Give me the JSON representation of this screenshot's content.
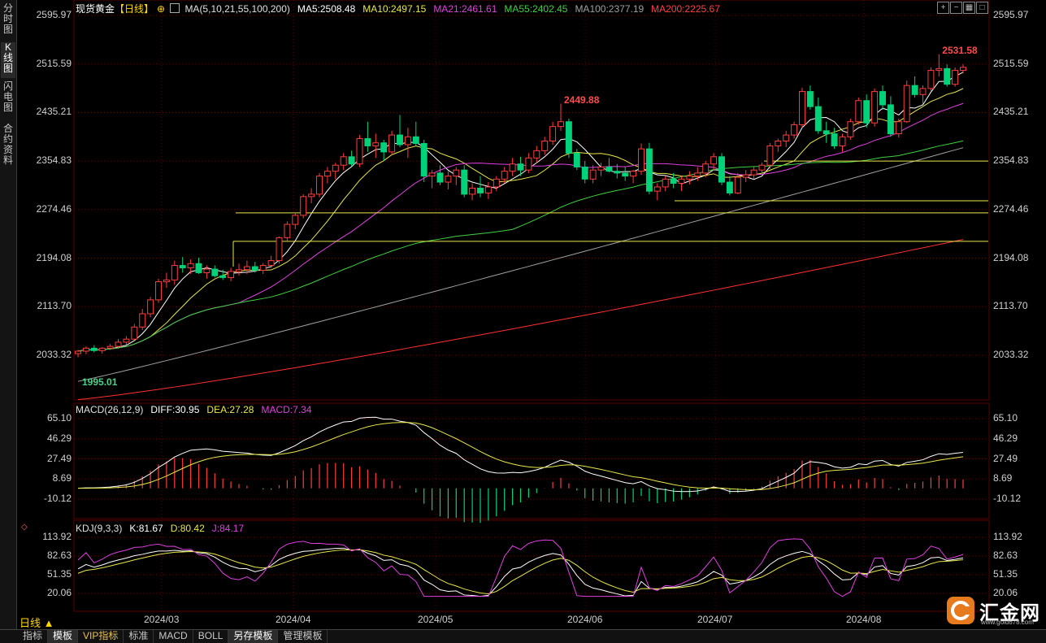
{
  "sidebar": {
    "tabs": [
      "分时图",
      "K线图",
      "闪电图",
      "合约资料"
    ],
    "active": 1
  },
  "header": {
    "symbol": "现货黄金",
    "period_tag": "【日线】",
    "ma": [
      {
        "text": "MA(5,10,21,55,100,200)",
        "color": "#e0e0e0"
      },
      {
        "text": "MA5:2508.48",
        "color": "#ffffff"
      },
      {
        "text": "MA10:2497.15",
        "color": "#e8e84a"
      },
      {
        "text": "MA21:2461.61",
        "color": "#e040e0"
      },
      {
        "text": "MA55:2402.45",
        "color": "#40d040"
      },
      {
        "text": "MA100:2377.19",
        "color": "#a0a0a0"
      },
      {
        "text": "MA200:2225.67",
        "color": "#ff4040"
      }
    ]
  },
  "macd_legend": [
    {
      "text": "MACD(26,12,9)",
      "color": "#e0e0e0"
    },
    {
      "text": "DIFF:30.95",
      "color": "#ffffff"
    },
    {
      "text": "DEA:27.28",
      "color": "#e8e84a"
    },
    {
      "text": "MACD:7.34",
      "color": "#e040e0"
    }
  ],
  "kdj_legend": [
    {
      "text": "KDJ(9,3,3)",
      "color": "#e0e0e0"
    },
    {
      "text": "K:81.67",
      "color": "#ffffff"
    },
    {
      "text": "D:80.42",
      "color": "#e8e84a"
    },
    {
      "text": "J:84.17",
      "color": "#e040e0"
    }
  ],
  "price_axis": [
    "2595.97",
    "2515.59",
    "2435.21",
    "2354.83",
    "2274.46",
    "2194.08",
    "2113.70",
    "2033.32"
  ],
  "macd_axis": [
    "65.10",
    "46.29",
    "27.49",
    "8.69",
    "-10.12"
  ],
  "kdj_axis": [
    "113.92",
    "82.63",
    "51.35",
    "20.06"
  ],
  "time_axis": [
    "2024/03",
    "2024/04",
    "2024/05",
    "2024/06",
    "2024/07",
    "2024/08"
  ],
  "annotations": {
    "high": "2531.58",
    "mid_high": "2449.88",
    "low": "1995.01"
  },
  "colors": {
    "up": "#ff3c3c",
    "down": "#00d27a",
    "grid": "#5a0000",
    "bg": "#000000"
  },
  "period_button": "日线 ▲",
  "bottom_tabs": [
    {
      "label": "指标",
      "active": false,
      "vip": false
    },
    {
      "label": "模板",
      "active": true,
      "vip": false
    },
    {
      "label": "VIP指标",
      "active": false,
      "vip": true
    },
    {
      "label": "标准",
      "active": false,
      "vip": false
    },
    {
      "label": "MACD",
      "active": false,
      "vip": false
    },
    {
      "label": "BOLL",
      "active": false,
      "vip": false
    },
    {
      "label": "另存模板",
      "active": true,
      "vip": false
    },
    {
      "label": "管理模板",
      "active": false,
      "vip": false
    }
  ],
  "logo": {
    "name": "汇金网",
    "url": "www.gold678.com"
  },
  "chart_data": {
    "type": "candlestick",
    "ohlc": [
      [
        2036,
        2042,
        2030,
        2040
      ],
      [
        2040,
        2048,
        2035,
        2045
      ],
      [
        2045,
        2050,
        2038,
        2041
      ],
      [
        2041,
        2047,
        2036,
        2045
      ],
      [
        2045,
        2052,
        2042,
        2048
      ],
      [
        2048,
        2060,
        2044,
        2055
      ],
      [
        2055,
        2065,
        2050,
        2060
      ],
      [
        2060,
        2085,
        2058,
        2080
      ],
      [
        2080,
        2110,
        2075,
        2102
      ],
      [
        2102,
        2130,
        2096,
        2125
      ],
      [
        2125,
        2160,
        2120,
        2155
      ],
      [
        2155,
        2170,
        2145,
        2158
      ],
      [
        2158,
        2190,
        2150,
        2182
      ],
      [
        2182,
        2196,
        2170,
        2178
      ],
      [
        2178,
        2192,
        2168,
        2185
      ],
      [
        2185,
        2195,
        2168,
        2170
      ],
      [
        2170,
        2182,
        2160,
        2176
      ],
      [
        2176,
        2182,
        2162,
        2165
      ],
      [
        2165,
        2175,
        2158,
        2162
      ],
      [
        2162,
        2178,
        2156,
        2172
      ],
      [
        2172,
        2185,
        2165,
        2175
      ],
      [
        2175,
        2190,
        2168,
        2180
      ],
      [
        2180,
        2188,
        2170,
        2174
      ],
      [
        2174,
        2186,
        2168,
        2182
      ],
      [
        2182,
        2198,
        2178,
        2190
      ],
      [
        2190,
        2230,
        2185,
        2228
      ],
      [
        2228,
        2255,
        2222,
        2250
      ],
      [
        2250,
        2270,
        2242,
        2265
      ],
      [
        2265,
        2300,
        2260,
        2296
      ],
      [
        2296,
        2310,
        2285,
        2300
      ],
      [
        2300,
        2335,
        2295,
        2330
      ],
      [
        2330,
        2345,
        2318,
        2338
      ],
      [
        2338,
        2352,
        2325,
        2348
      ],
      [
        2348,
        2368,
        2340,
        2362
      ],
      [
        2362,
        2372,
        2346,
        2350
      ],
      [
        2350,
        2398,
        2345,
        2392
      ],
      [
        2392,
        2420,
        2370,
        2380
      ],
      [
        2380,
        2400,
        2360,
        2385
      ],
      [
        2385,
        2390,
        2355,
        2370
      ],
      [
        2370,
        2405,
        2365,
        2398
      ],
      [
        2398,
        2431,
        2378,
        2382
      ],
      [
        2382,
        2410,
        2360,
        2395
      ],
      [
        2395,
        2420,
        2380,
        2384
      ],
      [
        2384,
        2390,
        2320,
        2330
      ],
      [
        2330,
        2340,
        2310,
        2335
      ],
      [
        2335,
        2348,
        2315,
        2320
      ],
      [
        2320,
        2338,
        2308,
        2330
      ],
      [
        2330,
        2345,
        2315,
        2340
      ],
      [
        2340,
        2348,
        2295,
        2300
      ],
      [
        2300,
        2318,
        2290,
        2310
      ],
      [
        2310,
        2330,
        2295,
        2302
      ],
      [
        2302,
        2320,
        2292,
        2312
      ],
      [
        2312,
        2330,
        2305,
        2325
      ],
      [
        2325,
        2345,
        2318,
        2338
      ],
      [
        2338,
        2360,
        2330,
        2350
      ],
      [
        2350,
        2362,
        2330,
        2340
      ],
      [
        2340,
        2368,
        2335,
        2360
      ],
      [
        2360,
        2380,
        2352,
        2372
      ],
      [
        2372,
        2395,
        2365,
        2388
      ],
      [
        2388,
        2420,
        2382,
        2412
      ],
      [
        2412,
        2449.88,
        2405,
        2420
      ],
      [
        2420,
        2425,
        2360,
        2368
      ],
      [
        2368,
        2375,
        2340,
        2345
      ],
      [
        2345,
        2355,
        2318,
        2325
      ],
      [
        2325,
        2348,
        2318,
        2340
      ],
      [
        2340,
        2352,
        2330,
        2345
      ],
      [
        2345,
        2360,
        2336,
        2338
      ],
      [
        2338,
        2350,
        2326,
        2335
      ],
      [
        2335,
        2345,
        2322,
        2330
      ],
      [
        2330,
        2340,
        2318,
        2338
      ],
      [
        2338,
        2384,
        2332,
        2375
      ],
      [
        2375,
        2385,
        2300,
        2305
      ],
      [
        2305,
        2318,
        2290,
        2312
      ],
      [
        2312,
        2330,
        2305,
        2325
      ],
      [
        2325,
        2335,
        2310,
        2318
      ],
      [
        2318,
        2330,
        2305,
        2325
      ],
      [
        2325,
        2338,
        2316,
        2330
      ],
      [
        2330,
        2345,
        2322,
        2335
      ],
      [
        2335,
        2355,
        2328,
        2350
      ],
      [
        2350,
        2368,
        2340,
        2362
      ],
      [
        2362,
        2368,
        2315,
        2320
      ],
      [
        2320,
        2330,
        2298,
        2302
      ],
      [
        2302,
        2335,
        2300,
        2328
      ],
      [
        2328,
        2340,
        2320,
        2332
      ],
      [
        2332,
        2345,
        2325,
        2340
      ],
      [
        2340,
        2352,
        2332,
        2348
      ],
      [
        2348,
        2385,
        2342,
        2380
      ],
      [
        2380,
        2392,
        2370,
        2388
      ],
      [
        2388,
        2405,
        2378,
        2398
      ],
      [
        2398,
        2420,
        2392,
        2415
      ],
      [
        2415,
        2476,
        2410,
        2470
      ],
      [
        2470,
        2480,
        2440,
        2445
      ],
      [
        2445,
        2460,
        2400,
        2405
      ],
      [
        2405,
        2420,
        2385,
        2400
      ],
      [
        2400,
        2410,
        2375,
        2380
      ],
      [
        2380,
        2400,
        2370,
        2395
      ],
      [
        2395,
        2425,
        2390,
        2420
      ],
      [
        2420,
        2460,
        2415,
        2455
      ],
      [
        2455,
        2465,
        2410,
        2418
      ],
      [
        2418,
        2475,
        2412,
        2470
      ],
      [
        2470,
        2480,
        2440,
        2448
      ],
      [
        2448,
        2462,
        2395,
        2400
      ],
      [
        2400,
        2425,
        2394,
        2420
      ],
      [
        2420,
        2488,
        2418,
        2480
      ],
      [
        2480,
        2495,
        2460,
        2465
      ],
      [
        2465,
        2480,
        2450,
        2475
      ],
      [
        2475,
        2510,
        2470,
        2505
      ],
      [
        2505,
        2531.58,
        2495,
        2508
      ],
      [
        2508,
        2515,
        2478,
        2482
      ],
      [
        2482,
        2510,
        2478,
        2505
      ],
      [
        2505,
        2515,
        2500,
        2510
      ]
    ],
    "last_index_low_label": 0,
    "title": "现货黄金 日线"
  }
}
